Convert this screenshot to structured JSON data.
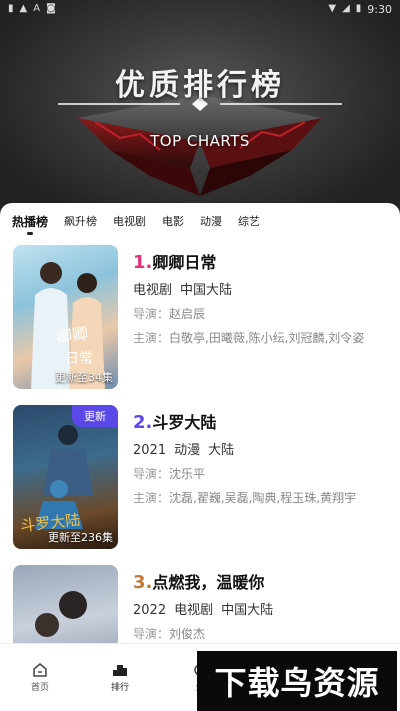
{
  "status_bar": {
    "time": "9:30",
    "left_icons": [
      "sim-card-icon",
      "alert-icon",
      "font-icon",
      "notification-a-icon"
    ],
    "right_icons": [
      "wifi-icon",
      "signal-icon",
      "battery-icon"
    ]
  },
  "hero": {
    "title": "优质排行榜",
    "subtitle": "TOP CHARTS"
  },
  "tabs": [
    {
      "label": "热播榜",
      "active": true
    },
    {
      "label": "飙升榜",
      "active": false
    },
    {
      "label": "电视剧",
      "active": false
    },
    {
      "label": "电影",
      "active": false
    },
    {
      "label": "动漫",
      "active": false
    },
    {
      "label": "综艺",
      "active": false
    }
  ],
  "items": [
    {
      "rank": "1.",
      "rank_color": "#e0307a",
      "title": "卿卿日常",
      "meta": [
        "电视剧",
        "中国大陆"
      ],
      "director_label": "导演：",
      "director": "赵启辰",
      "cast_label": "主演：",
      "cast": "白敬亭,田曦薇,陈小纭,刘冠麟,刘令姿",
      "poster_caption": "更新至34集",
      "badge": ""
    },
    {
      "rank": "2.",
      "rank_color": "#5b48e8",
      "title": "斗罗大陆",
      "meta": [
        "2021",
        "动漫",
        "大陆"
      ],
      "director_label": "导演：",
      "director": "沈乐平",
      "cast_label": "主演：",
      "cast": "沈磊,翟巍,吴磊,陶典,程玉珠,黄翔宇",
      "poster_caption": "更新至236集",
      "badge": "更新"
    },
    {
      "rank": "3.",
      "rank_color": "#c07a3a",
      "title": "点燃我，温暖你",
      "meta": [
        "2022",
        "电视剧",
        "中国大陆"
      ],
      "director_label": "导演：",
      "director": "刘俊杰",
      "cast_label": "",
      "cast": "",
      "poster_caption": "",
      "badge": ""
    }
  ],
  "bottom_nav": [
    {
      "label": "首页",
      "icon": "home-icon",
      "active": false
    },
    {
      "label": "排行",
      "icon": "ranking-icon",
      "active": true
    },
    {
      "label": "分",
      "icon": "category-icon",
      "active": false
    }
  ],
  "watermark": "下载鸟资源"
}
